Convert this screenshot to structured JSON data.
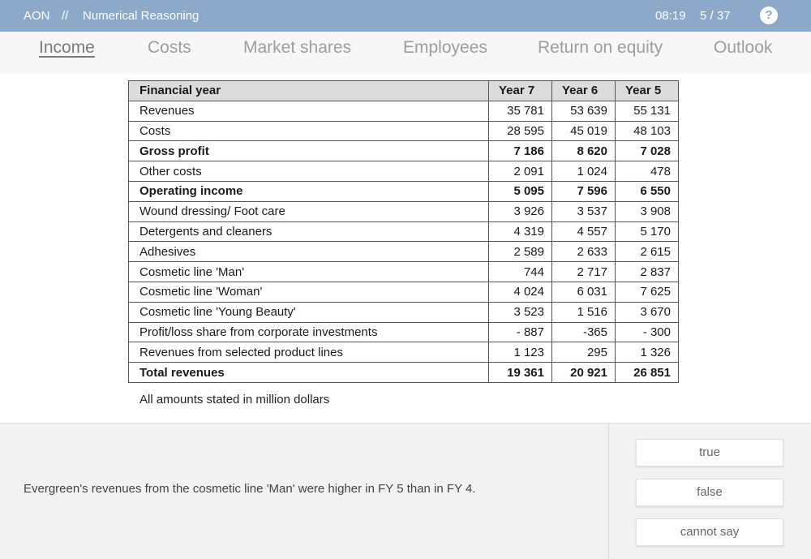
{
  "topbar": {
    "brand": "AON",
    "separator": "//",
    "section": "Numerical Reasoning",
    "time": "08:19",
    "counter": "5 / 37",
    "help_label": "?"
  },
  "tabs": [
    {
      "label": "Income",
      "active": true
    },
    {
      "label": "Costs"
    },
    {
      "label": "Market shares"
    },
    {
      "label": "Employees"
    },
    {
      "label": "Return on equity"
    },
    {
      "label": "Outlook"
    }
  ],
  "table": {
    "headers": [
      "Financial year",
      "Year 7",
      "Year 6",
      "Year 5"
    ],
    "rows": [
      {
        "label": "Revenues",
        "values": [
          "35 781",
          "53 639",
          "55 131"
        ]
      },
      {
        "label": "Costs",
        "values": [
          "28 595",
          "45 019",
          "48 103"
        ]
      },
      {
        "label": "Gross profit",
        "values": [
          "7 186",
          "8 620",
          "7 028"
        ]
      },
      {
        "label": "Other costs",
        "values": [
          "2 091",
          "1 024",
          "478"
        ]
      },
      {
        "label": "Operating income",
        "values": [
          "5 095",
          "7 596",
          "6 550"
        ]
      },
      {
        "label": "Wound dressing/ Foot care",
        "values": [
          "3 926",
          "3 537",
          "3 908"
        ]
      },
      {
        "label": "Detergents and cleaners",
        "values": [
          "4 319",
          "4 557",
          "5 170"
        ]
      },
      {
        "label": "Adhesives",
        "values": [
          "2 589",
          "2 633",
          "2 615"
        ]
      },
      {
        "label": "Cosmetic line 'Man'",
        "values": [
          "744",
          "2 717",
          "2 837"
        ]
      },
      {
        "label": "Cosmetic line 'Woman'",
        "values": [
          "4 024",
          "6 031",
          "7 625"
        ]
      },
      {
        "label": "Cosmetic line 'Young Beauty'",
        "values": [
          "3 523",
          "1 516",
          "3 670"
        ]
      },
      {
        "label": "Profit/loss share from corporate investments",
        "values": [
          "- 887",
          "-365",
          "- 300"
        ]
      },
      {
        "label": "Revenues from selected product lines",
        "values": [
          "1 123",
          "295",
          "1 326"
        ]
      },
      {
        "label": "Total revenues",
        "values": [
          "19 361",
          "20 921",
          "26 851"
        ]
      }
    ],
    "note": "All amounts stated in million dollars"
  },
  "question": {
    "text": "Evergreen's revenues from the cosmetic line 'Man' were higher in FY 5 than in FY 4."
  },
  "answers": {
    "true_label": "true",
    "false_label": "false",
    "cannot_say_label": "cannot say"
  }
}
